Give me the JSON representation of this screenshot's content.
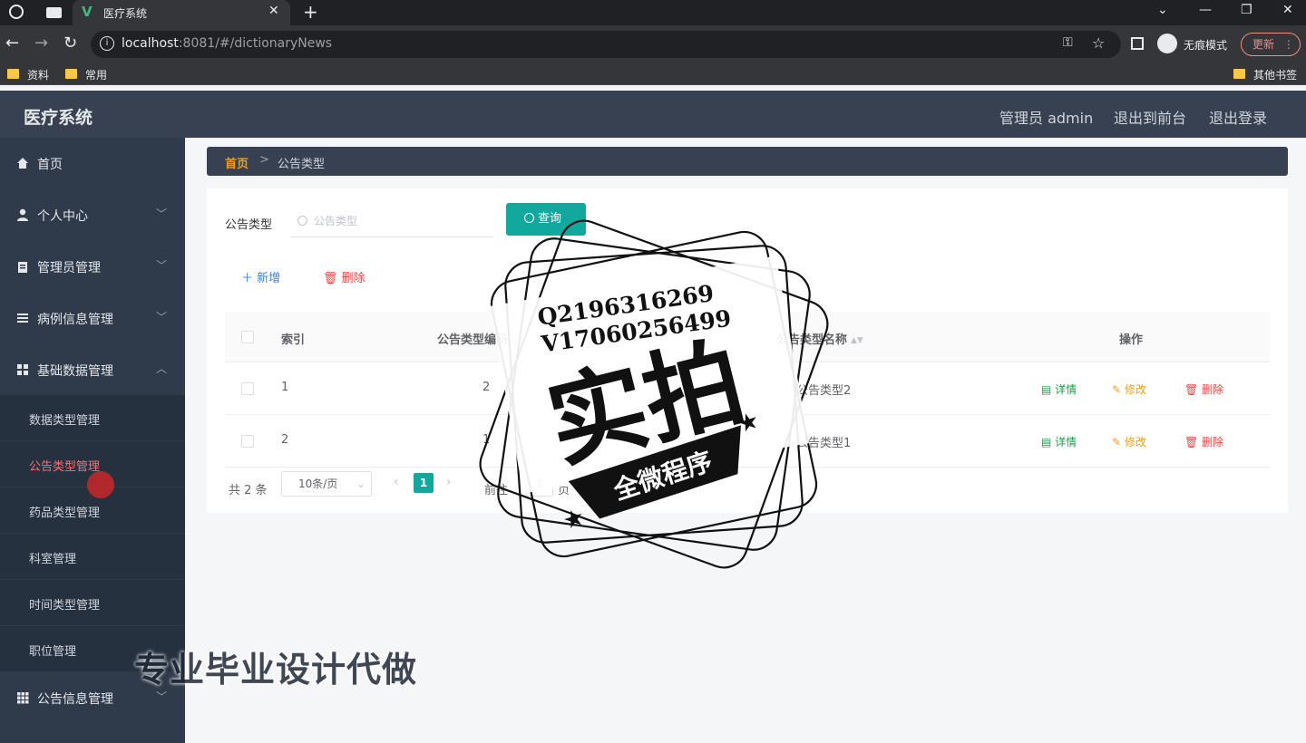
{
  "browser": {
    "tab_title": "医疗系统",
    "url_host": "localhost",
    "url_rest": ":8081/#/dictionaryNews",
    "incognito_label": "无痕模式",
    "update_label": "更新",
    "bookmarks": [
      "资料",
      "常用"
    ],
    "other_bookmarks": "其他书签"
  },
  "header": {
    "title": "医疗系统",
    "user": "管理员 admin",
    "to_front": "退出到前台",
    "logout": "退出登录"
  },
  "sidebar": {
    "items": [
      {
        "label": "首页"
      },
      {
        "label": "个人中心"
      },
      {
        "label": "管理员管理"
      },
      {
        "label": "病例信息管理"
      },
      {
        "label": "基础数据管理"
      }
    ],
    "sub_items": [
      {
        "label": "数据类型管理"
      },
      {
        "label": "公告类型管理"
      },
      {
        "label": "药品类型管理"
      },
      {
        "label": "科室管理"
      },
      {
        "label": "时间类型管理"
      },
      {
        "label": "职位管理"
      }
    ],
    "last_item": {
      "label": "公告信息管理"
    }
  },
  "breadcrumb": {
    "home": "首页",
    "separator": ">",
    "current": "公告类型"
  },
  "search": {
    "label": "公告类型",
    "placeholder": "公告类型",
    "button": "查询"
  },
  "actions": {
    "add": "新增",
    "delete": "删除"
  },
  "table": {
    "headers": {
      "index": "索引",
      "code": "公告类型编码",
      "name": "公告类型名称",
      "ops": "操作"
    },
    "rows": [
      {
        "index": "1",
        "code": "2",
        "name": "公告类型2"
      },
      {
        "index": "2",
        "code": "1",
        "name": "公告类型1"
      }
    ],
    "op_labels": {
      "detail": "详情",
      "edit": "修改",
      "delete": "删除"
    }
  },
  "pagination": {
    "total": "共 2 条",
    "page_size": "10条/页",
    "current_page": "1",
    "goto": "前往",
    "goto_value": "1",
    "page_suffix": "页"
  },
  "watermark": {
    "contact_q": "Q2196316269",
    "contact_v": "V17060256499",
    "big_text": "实拍",
    "banner": "全微程序",
    "bottom_text": "专业毕业设计代做"
  },
  "colors": {
    "accent": "#13a89e",
    "sidebar_bg": "#2f3a4a",
    "header_bg": "#374151",
    "active_menu": "#f87171"
  }
}
